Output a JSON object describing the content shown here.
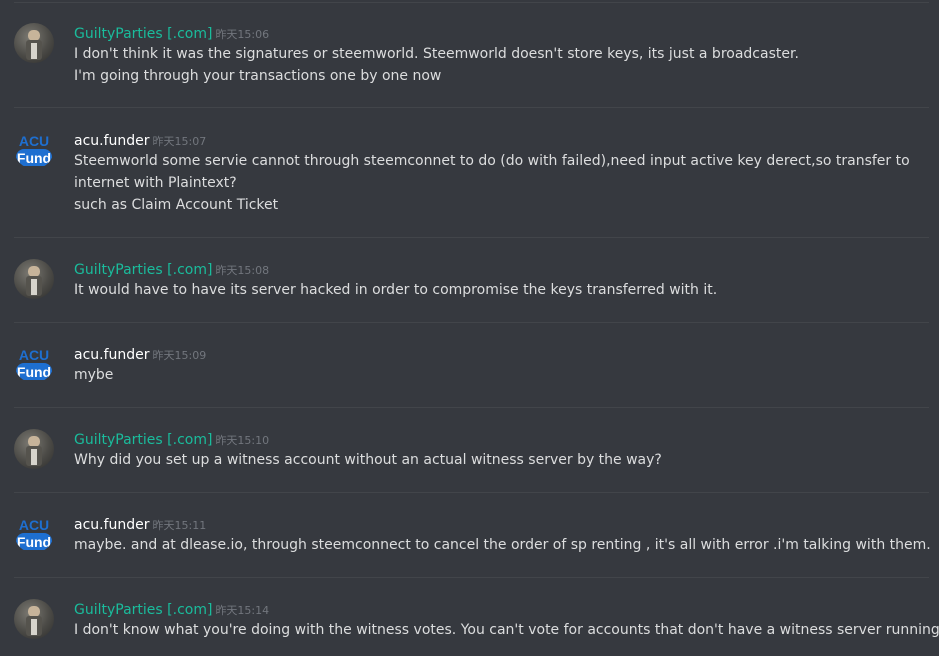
{
  "messages": [
    {
      "author": "GuiltyParties [.com]",
      "time": "昨天15:06",
      "lines": [
        "I don't think it was the signatures or steemworld. Steemworld doesn't store keys, its just a broadcaster.",
        "I'm going through your transactions one by one now"
      ]
    },
    {
      "author": "acu.funder",
      "time": "昨天15:07",
      "lines": [
        "Steemworld some servie cannot through steemconnet to do (do with failed),need input active key derect,so transfer to",
        "internet with Plaintext?",
        "such as Claim Account Ticket"
      ]
    },
    {
      "author": "GuiltyParties [.com]",
      "time": "昨天15:08",
      "lines": [
        "It would have to have its server hacked in order to compromise the keys transferred with it."
      ]
    },
    {
      "author": "acu.funder",
      "time": "昨天15:09",
      "lines": [
        "mybe"
      ]
    },
    {
      "author": "GuiltyParties [.com]",
      "time": "昨天15:10",
      "lines": [
        "Why did you set up a witness account without an actual witness server by the way?"
      ]
    },
    {
      "author": "acu.funder",
      "time": "昨天15:11",
      "lines": [
        "maybe. and at dlease.io, through steemconnect to cancel the order of sp  renting , it's all with error .i'm talking with them."
      ]
    },
    {
      "author": "GuiltyParties [.com]",
      "time": "昨天15:14",
      "lines": [
        "I don't know what you're doing with the witness votes.  You can't vote for accounts that don't have a witness server running."
      ]
    }
  ],
  "acu_logo": {
    "top_text": "ACU",
    "bottom_text": "Fund"
  },
  "colors": {
    "background": "#36393f",
    "author_guilty": "#1abc9c",
    "author_acu": "#ffffff",
    "message_text": "#dcddde",
    "timestamp": "#72767d",
    "acu_blue": "#1e6fd0"
  }
}
